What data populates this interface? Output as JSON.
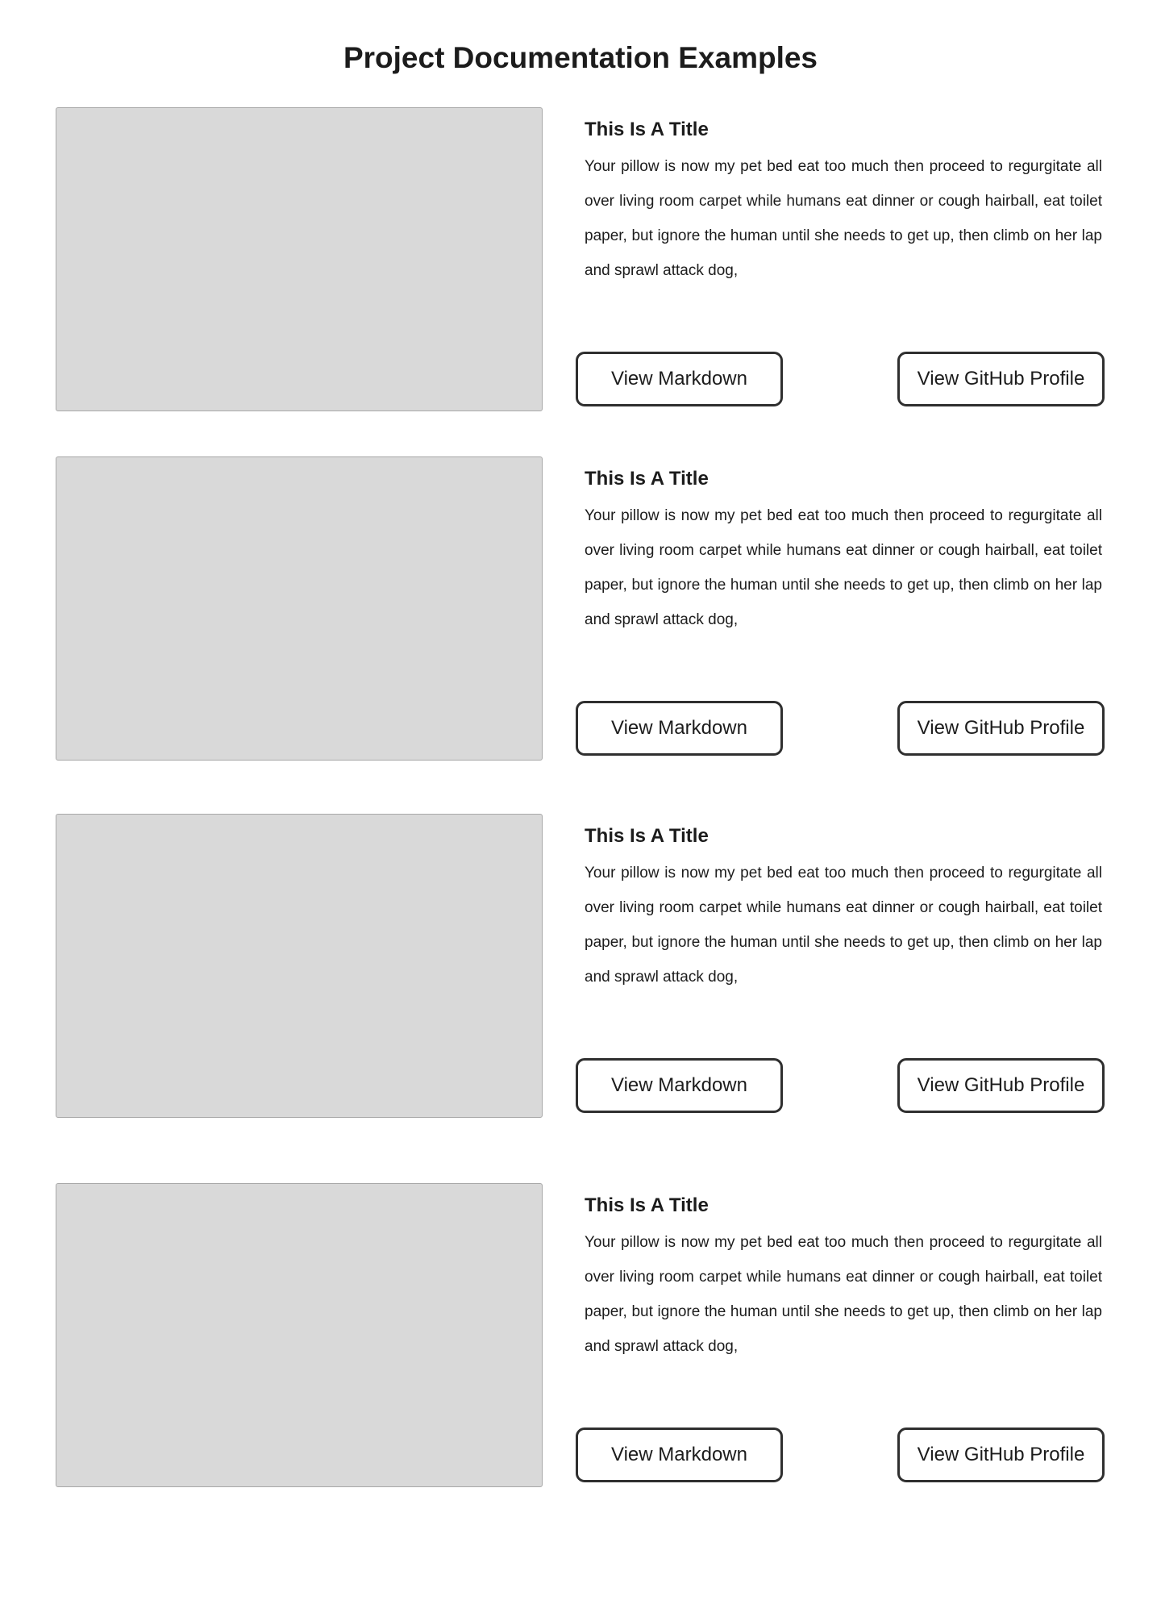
{
  "page": {
    "title": "Project Documentation Examples"
  },
  "cards": [
    {
      "title": "This Is A Title",
      "body": "Your pillow is now my pet bed eat too much then proceed to regurgitate all over living room carpet while humans eat dinner or cough hairball, eat toilet paper, but ignore the human until she needs to get up, then climb on her lap and sprawl attack dog,",
      "markdown_button": "View Markdown",
      "github_button": "View GitHub Profile"
    },
    {
      "title": "This Is A Title",
      "body": "Your pillow is now my pet bed eat too much then proceed to regurgitate all over living room carpet while humans eat dinner or cough hairball, eat toilet paper, but ignore the human until she needs to get up, then climb on her lap and sprawl attack dog,",
      "markdown_button": "View Markdown",
      "github_button": "View GitHub Profile"
    },
    {
      "title": "This Is A Title",
      "body": "Your pillow is now my pet bed eat too much then proceed to regurgitate all over living room carpet while humans eat dinner or cough hairball, eat toilet paper, but ignore the human until she needs to get up, then climb on her lap and sprawl attack dog,",
      "markdown_button": "View Markdown",
      "github_button": "View GitHub Profile"
    },
    {
      "title": "This Is A Title",
      "body": "Your pillow is now my pet bed eat too much then proceed to regurgitate all over living room carpet while humans eat dinner or cough hairball, eat toilet paper, but ignore the human until she needs to get up, then climb on her lap and sprawl attack dog,",
      "markdown_button": "View Markdown",
      "github_button": "View GitHub Profile"
    }
  ]
}
